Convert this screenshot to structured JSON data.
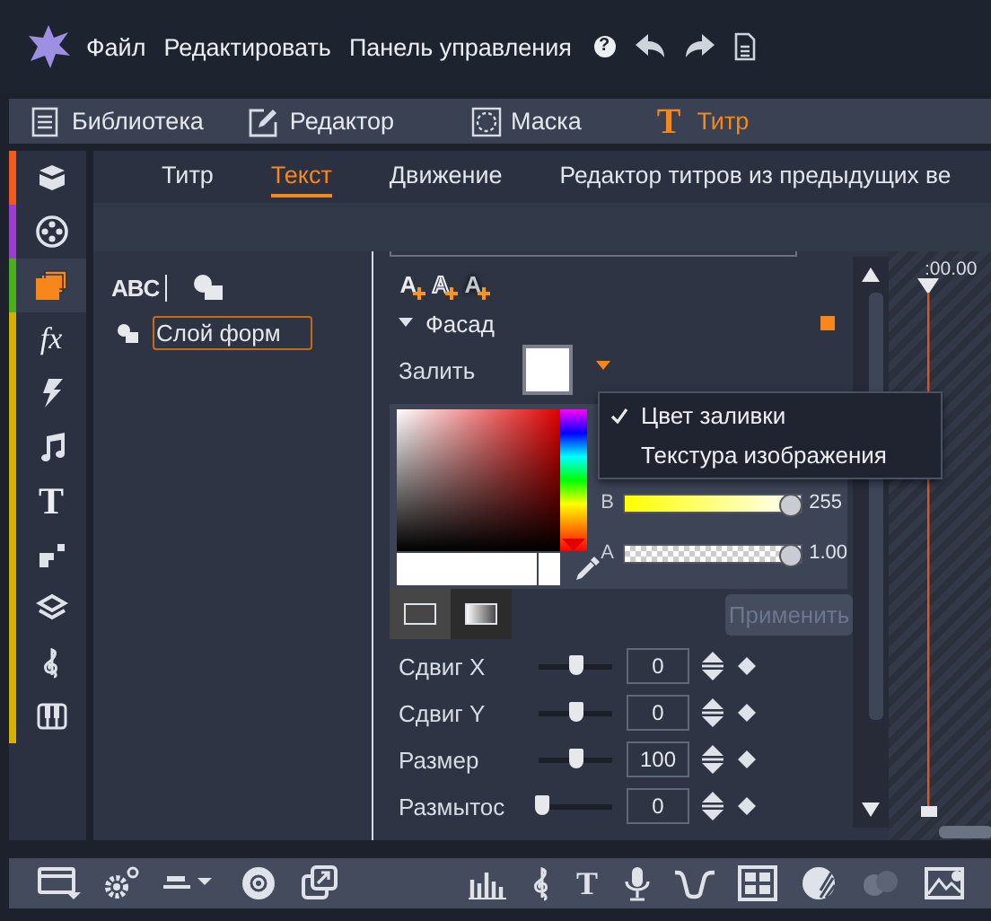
{
  "menu_bar": {
    "items": [
      "Файл",
      "Редактировать",
      "Панель управления"
    ],
    "help_glyph": "?"
  },
  "workspace_tabs": [
    {
      "label": "Библиотека",
      "selected": false
    },
    {
      "label": "Редактор",
      "selected": false
    },
    {
      "label": "Маска",
      "selected": false
    },
    {
      "label": "Титр",
      "glyph": "T",
      "selected": true
    }
  ],
  "side_tools": [
    {
      "color": "#f05a1e",
      "selected": false
    },
    {
      "color": "#9a3fd0",
      "selected": false
    },
    {
      "color": "#4cae1c",
      "selected": true
    },
    {
      "color": "#d4b000",
      "glyph": "fx",
      "selected": false
    },
    {
      "color": "#d4b000",
      "selected": false
    },
    {
      "color": "#d4b000",
      "selected": false
    },
    {
      "color": "#d4b000",
      "glyph": "T",
      "selected": false
    },
    {
      "color": "#d4b000",
      "selected": false
    },
    {
      "color": "#d4b000",
      "selected": false
    },
    {
      "color": "#d4b000",
      "selected": false
    },
    {
      "color": "#d4b000",
      "selected": false
    }
  ],
  "sub_tabs": [
    {
      "label": "Титр",
      "selected": false
    },
    {
      "label": "Текст",
      "selected": true
    },
    {
      "label": "Движение",
      "selected": false
    },
    {
      "label": "Редактор титров из предыдущих ве",
      "selected": false
    }
  ],
  "layers_panel": {
    "text_tool_label": "ABC",
    "layers": [
      {
        "name": "Слой форм"
      }
    ]
  },
  "properties": {
    "style_presets": [
      {
        "kind": "solid",
        "glyph": "A"
      },
      {
        "kind": "outline",
        "glyph": "A"
      },
      {
        "kind": "shadow",
        "glyph": "A"
      }
    ],
    "section": {
      "title": "Фасад",
      "expanded": true
    },
    "fill_label": "Залить",
    "hue_slider": {
      "level": 0
    },
    "channels": [
      {
        "label": "B",
        "level": 0.94,
        "reading": "255"
      },
      {
        "label": "A",
        "level": 0.94,
        "reading": "1.00"
      }
    ],
    "fill_modes": [
      {
        "kind": "solid",
        "selected": true
      },
      {
        "kind": "gradient",
        "selected": false
      }
    ],
    "apply_button": {
      "label": "Применить",
      "disabled": true
    },
    "params": [
      {
        "label": "Сдвиг X",
        "level": 0.5,
        "value": "0"
      },
      {
        "label": "Сдвиг Y",
        "level": 0.5,
        "value": "0"
      },
      {
        "label": "Размер",
        "level": 0.5,
        "value": "100"
      },
      {
        "label": "Размытос",
        "level": 0.05,
        "value": "0"
      }
    ]
  },
  "fill_menu": [
    {
      "label": "Цвет заливки",
      "checked": true
    },
    {
      "label": "Текстура изображения",
      "checked": false
    }
  ],
  "timeline": {
    "timecode": ":00.00"
  },
  "bottom_toolbar": {
    "text_tool_glyph": "T"
  }
}
